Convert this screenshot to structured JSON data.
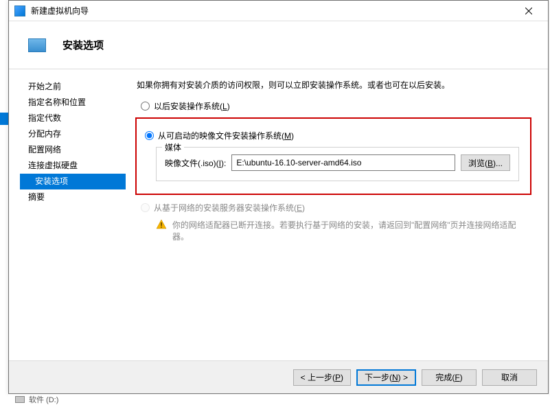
{
  "titlebar": {
    "title": "新建虚拟机向导"
  },
  "header": {
    "title": "安装选项"
  },
  "sidebar": {
    "items": [
      {
        "label": "开始之前"
      },
      {
        "label": "指定名称和位置"
      },
      {
        "label": "指定代数"
      },
      {
        "label": "分配内存"
      },
      {
        "label": "配置网络"
      },
      {
        "label": "连接虚拟硬盘"
      },
      {
        "label": "安装选项",
        "active": true
      },
      {
        "label": "摘要"
      }
    ]
  },
  "content": {
    "description": "如果你拥有对安装介质的访问权限，则可以立即安装操作系统。或者也可在以后安装。",
    "radio_later_prefix": "以后安装操作系统(",
    "radio_later_key": "L",
    "radio_later_suffix": ")",
    "radio_iso_prefix": "从可启动的映像文件安装操作系统(",
    "radio_iso_key": "M",
    "radio_iso_suffix": ")",
    "radio_net_prefix": "从基于网络的安装服务器安装操作系统(",
    "radio_net_key": "E",
    "radio_net_suffix": ")",
    "media_legend": "媒体",
    "media_label_prefix": "映像文件(.iso)(",
    "media_label_key": "I",
    "media_label_suffix": "):",
    "iso_path": "E:\\ubuntu-16.10-server-amd64.iso",
    "browse_prefix": "浏览(",
    "browse_key": "B",
    "browse_suffix": ")...",
    "network_warning": "你的网络适配器已断开连接。若要执行基于网络的安装，请返回到\"配置网络\"页并连接网络适配器。"
  },
  "footer": {
    "prev_prefix": "< 上一步(",
    "prev_key": "P",
    "prev_suffix": ")",
    "next_prefix": "下一步(",
    "next_key": "N",
    "next_suffix": ") >",
    "finish_prefix": "完成(",
    "finish_key": "F",
    "finish_suffix": ")",
    "cancel": "取消"
  },
  "bottom_strip": {
    "text": "软件 (D:)"
  }
}
